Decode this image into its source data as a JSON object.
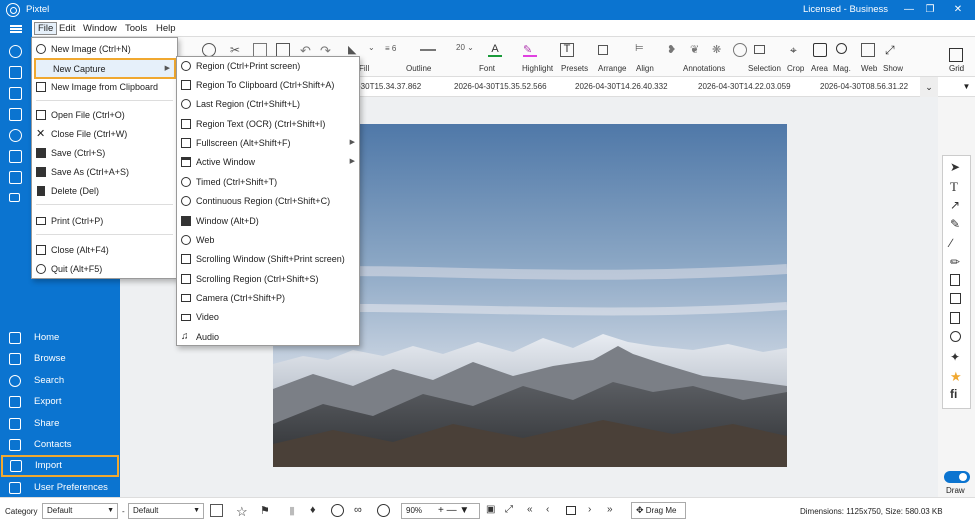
{
  "app": {
    "title": "Pixtel",
    "license": "Licensed - Business"
  },
  "menubar": {
    "items": [
      "File",
      "Edit",
      "Window",
      "Tools",
      "Help"
    ]
  },
  "file_menu": {
    "items": [
      "New Image (Ctrl+N)",
      "New Capture",
      "New Image from Clipboard",
      "",
      "Open File (Ctrl+O)",
      "Close File (Ctrl+W)",
      "Save (Ctrl+S)",
      "Save As (Ctrl+A+S)",
      "Delete (Del)",
      "",
      "Print (Ctrl+P)",
      "",
      "Close (Alt+F4)",
      "Quit (Alt+F5)"
    ]
  },
  "submenu": {
    "items": [
      {
        "label": "Region (Ctrl+Print screen)",
        "icon": "region-icon"
      },
      {
        "label": "Region To Clipboard (Ctrl+Shift+A)",
        "icon": "clipboard-icon"
      },
      {
        "label": "Last Region (Ctrl+Shift+L)",
        "icon": "last-region-icon"
      },
      {
        "label": "Region Text (OCR) (Ctrl+Shift+I)",
        "icon": "ocr-icon"
      },
      {
        "label": "Fullscreen (Alt+Shift+F)",
        "icon": "fullscreen-icon"
      },
      {
        "label": "Active Window",
        "icon": "window-icon"
      },
      {
        "label": "Timed (Ctrl+Shift+T)",
        "icon": "timer-icon"
      },
      {
        "label": "Continuous Region (Ctrl+Shift+C)",
        "icon": "continuous-icon"
      },
      {
        "label": "Window (Alt+D)",
        "icon": "windows-logo-icon"
      },
      {
        "label": "Web",
        "icon": "globe-icon"
      },
      {
        "label": "Scrolling Window (Shift+Print screen)",
        "icon": "scroll-window-icon"
      },
      {
        "label": "Scrolling Region (Ctrl+Shift+S)",
        "icon": "scroll-region-icon"
      },
      {
        "label": "Camera (Ctrl+Shift+P)",
        "icon": "camera-icon"
      },
      {
        "label": "Video",
        "icon": "video-icon"
      },
      {
        "label": "Audio",
        "icon": "audio-icon"
      }
    ]
  },
  "sidebar": {
    "nav": [
      "Home",
      "Browse",
      "Search",
      "Export",
      "Share",
      "Contacts",
      "Import",
      "User Preferences"
    ]
  },
  "toolbar": {
    "labels": [
      "Fill",
      "Outline",
      "Font",
      "Highlight",
      "Presets",
      "Arrange",
      "Align",
      "Annotations",
      "Selection",
      "Crop",
      "Area",
      "Mag.",
      "Web",
      "Show",
      "Grid"
    ],
    "stroke_width": "6",
    "font_size": "20",
    "font_color_letter": "A",
    "presets_letter": "T"
  },
  "tabs": [
    "-30T15.34.37.862",
    "2026-04-30T15.35.52.566",
    "2026-04-30T14.26.40.332",
    "2026-04-30T14.22.03.059",
    "2026-04-30T08.56.31.22"
  ],
  "status": {
    "category_label": "Category",
    "category_value": "Default",
    "dash": "-",
    "second_value": "Default",
    "zoom": "90%",
    "drag": "Drag Me",
    "dimensions": "Dimensions: 1125x750, Size: 580.03 KB"
  },
  "right_tools": {
    "draw_label": "Draw",
    "fi_label": "fi"
  },
  "colors": {
    "brand": "#0b74d0",
    "highlight": "#f0a830"
  }
}
